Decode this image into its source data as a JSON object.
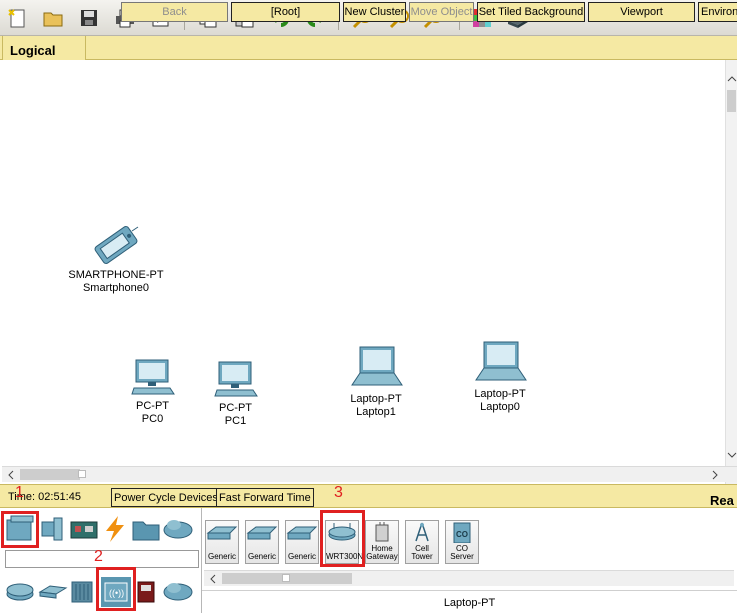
{
  "toolbar": {
    "icons": [
      "new-file",
      "open-folder",
      "save",
      "print",
      "activity-wizard",
      "copy",
      "paste",
      "undo",
      "redo",
      "zoom-in",
      "zoom-reset",
      "zoom-out",
      "palette",
      "custom-device"
    ]
  },
  "logical_bar": {
    "tab_label": "Logical",
    "back": "Back",
    "root": "[Root]",
    "new_cluster": "New Cluster",
    "move_object": "Move Object",
    "set_tiled_background": "Set Tiled Background",
    "viewport": "Viewport",
    "environment": "Environ"
  },
  "canvas": {
    "devices": [
      {
        "type": "SMARTPHONE-PT",
        "name": "Smartphone0"
      },
      {
        "type": "PC-PT",
        "name": "PC0"
      },
      {
        "type": "PC-PT",
        "name": "PC1"
      },
      {
        "type": "Laptop-PT",
        "name": "Laptop1"
      },
      {
        "type": "Laptop-PT",
        "name": "Laptop0"
      }
    ]
  },
  "status_bar": {
    "time": "Time: 02:51:45",
    "power_cycle": "Power Cycle Devices",
    "fast_forward": "Fast Forward Time",
    "realtime": "Rea"
  },
  "device_panel": {
    "tiles": [
      "Generic",
      "Generic",
      "Generic",
      "WRT300N",
      "Home Gateway",
      "Cell Tower",
      "CO Server"
    ],
    "selected_label": "Laptop-PT"
  },
  "annotations": {
    "one": "1",
    "two": "2",
    "three": "3"
  },
  "colors": {
    "accent_yellow": "#f5e9a3",
    "highlight_red": "#e02020",
    "device_teal": "#4a8fb0"
  }
}
